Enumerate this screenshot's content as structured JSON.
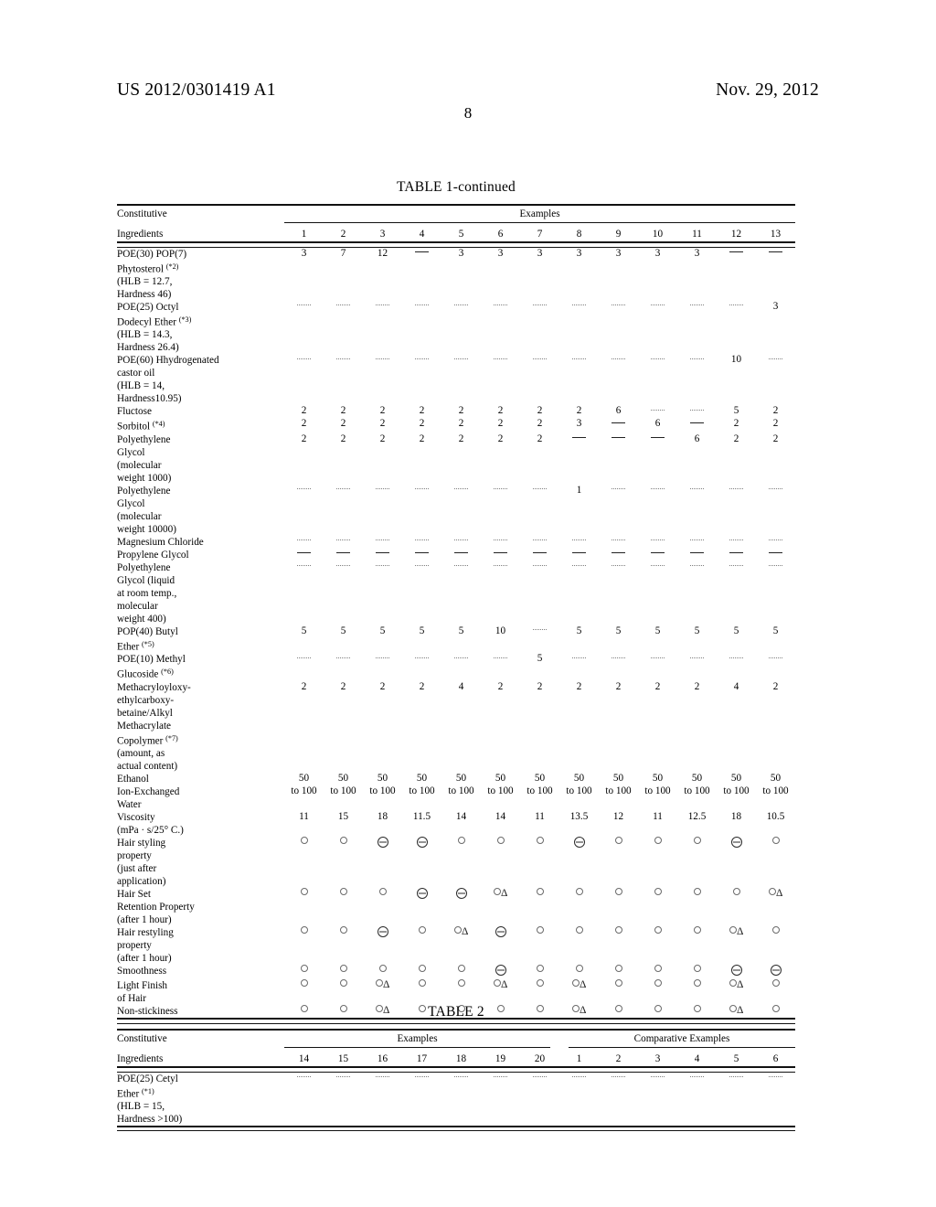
{
  "header": {
    "patent_number": "US 2012/0301419 A1",
    "date": "Nov. 29, 2012",
    "page_number": "8"
  },
  "table1": {
    "caption": "TABLE 1-continued",
    "stub_header_line1": "Constitutive",
    "stub_header_line2": "Ingredients",
    "groups": [
      {
        "label": "Examples",
        "span": 13
      }
    ],
    "columns": [
      "1",
      "2",
      "3",
      "4",
      "5",
      "6",
      "7",
      "8",
      "9",
      "10",
      "11",
      "12",
      "13"
    ],
    "rows": [
      {
        "label": "POE(30) POP(7)\nPhytosterol (*2)\n(HLB = 12.7,\nHardness 46)",
        "label_sup": "*2",
        "values": [
          "3",
          "7",
          "12",
          "DASH",
          "3",
          "3",
          "3",
          "3",
          "3",
          "3",
          "3",
          "DASH",
          "DASH"
        ]
      },
      {
        "label": "POE(25) Octyl\nDodecyl Ether (*3)\n(HLB = 14.3,\nHardness 26.4)",
        "label_sup": "*3",
        "values": [
          "FAINT",
          "FAINT",
          "FAINT",
          "FAINT",
          "FAINT",
          "FAINT",
          "FAINT",
          "FAINT",
          "FAINT",
          "FAINT",
          "FAINT",
          "FAINT",
          "3"
        ]
      },
      {
        "label": "POE(60) Hhydrogenated\ncastor oil\n(HLB = 14,\nHardness10.95)",
        "values": [
          "FAINT",
          "FAINT",
          "FAINT",
          "FAINT",
          "FAINT",
          "FAINT",
          "FAINT",
          "FAINT",
          "FAINT",
          "FAINT",
          "FAINT",
          "10",
          "FAINT"
        ]
      },
      {
        "label": "Fluctose",
        "values": [
          "2",
          "2",
          "2",
          "2",
          "2",
          "2",
          "2",
          "2",
          "6",
          "FAINT",
          "FAINT",
          "5",
          "2"
        ]
      },
      {
        "label": "Sorbitol (*4)",
        "label_sup": "*4",
        "values": [
          "2",
          "2",
          "2",
          "2",
          "2",
          "2",
          "2",
          "3",
          "DASH",
          "6",
          "DASH",
          "2",
          "2"
        ]
      },
      {
        "label": "Polyethylene\nGlycol\n(molecular\nweight 1000)",
        "values": [
          "2",
          "2",
          "2",
          "2",
          "2",
          "2",
          "2",
          "DASH",
          "DASH",
          "DASH",
          "6",
          "2",
          "2"
        ]
      },
      {
        "label": "Polyethylene\nGlycol\n(molecular\nweight 10000)",
        "values": [
          "FAINT",
          "FAINT",
          "FAINT",
          "FAINT",
          "FAINT",
          "FAINT",
          "FAINT",
          "1",
          "FAINT",
          "FAINT",
          "FAINT",
          "FAINT",
          "FAINT"
        ]
      },
      {
        "label": "Magnesium Chloride",
        "values": [
          "FAINT",
          "FAINT",
          "FAINT",
          "FAINT",
          "FAINT",
          "FAINT",
          "FAINT",
          "FAINT",
          "FAINT",
          "FAINT",
          "FAINT",
          "FAINT",
          "FAINT"
        ]
      },
      {
        "label": "Propylene Glycol",
        "values": [
          "DASH",
          "DASH",
          "DASH",
          "DASH",
          "DASH",
          "DASH",
          "DASH",
          "DASH",
          "DASH",
          "DASH",
          "DASH",
          "DASH",
          "DASH"
        ]
      },
      {
        "label": "Polyethylene\nGlycol (liquid\nat room temp.,\nmolecular\nweight 400)",
        "values": [
          "FAINT",
          "FAINT",
          "FAINT",
          "FAINT",
          "FAINT",
          "FAINT",
          "FAINT",
          "FAINT",
          "FAINT",
          "FAINT",
          "FAINT",
          "FAINT",
          "FAINT"
        ]
      },
      {
        "label": "POP(40) Butyl\nEther (*5)",
        "label_sup": "*5",
        "values": [
          "5",
          "5",
          "5",
          "5",
          "5",
          "10",
          "FAINT",
          "5",
          "5",
          "5",
          "5",
          "5",
          "5"
        ]
      },
      {
        "label": "POE(10) Methyl\nGlucoside (*6)",
        "label_sup": "*6",
        "values": [
          "FAINT",
          "FAINT",
          "FAINT",
          "FAINT",
          "FAINT",
          "FAINT",
          "5",
          "FAINT",
          "FAINT",
          "FAINT",
          "FAINT",
          "FAINT",
          "FAINT"
        ]
      },
      {
        "label": "Methacryloyloxy-\nethylcarboxy-\nbetaine/Alkyl\nMethacrylate\nCopolymer (*7)\n(amount, as\nactual content)",
        "label_sup": "*7",
        "values": [
          "2",
          "2",
          "2",
          "2",
          "4",
          "2",
          "2",
          "2",
          "2",
          "2",
          "2",
          "4",
          "2"
        ]
      },
      {
        "label": "Ethanol",
        "values": [
          "50",
          "50",
          "50",
          "50",
          "50",
          "50",
          "50",
          "50",
          "50",
          "50",
          "50",
          "50",
          "50"
        ]
      },
      {
        "label": "Ion-Exchanged\nWater",
        "values": [
          "to 100",
          "to 100",
          "to 100",
          "to 100",
          "to 100",
          "to 100",
          "to 100",
          "to 100",
          "to 100",
          "to 100",
          "to 100",
          "to 100",
          "to 100"
        ]
      },
      {
        "label": "Viscosity\n(mPa · s/25° C.)",
        "values": [
          "11",
          "15",
          "18",
          "11.5",
          "14",
          "14",
          "11",
          "13.5",
          "12",
          "11",
          "12.5",
          "18",
          "10.5"
        ]
      },
      {
        "label": "Hair styling\nproperty\n(just after\napplication)",
        "values": [
          "CIRCLE",
          "CIRCLE",
          "CDASH",
          "CDASH",
          "CIRCLE",
          "CIRCLE",
          "CIRCLE",
          "CDASH",
          "CIRCLE",
          "CIRCLE",
          "CIRCLE",
          "CDASH",
          "CIRCLE"
        ]
      },
      {
        "label": "Hair Set\nRetention Property\n(after 1 hour)",
        "values": [
          "CIRCLE",
          "CIRCLE",
          "CIRCLE",
          "CDASH",
          "CDASH",
          "CIRCTRI",
          "CIRCLE",
          "CIRCLE",
          "CIRCLE",
          "CIRCLE",
          "CIRCLE",
          "CIRCLE",
          "CIRCTRI"
        ]
      },
      {
        "label": "Hair restyling\nproperty\n(after 1 hour)",
        "values": [
          "CIRCLE",
          "CIRCLE",
          "CDASH",
          "CIRCLE",
          "CIRCTRI",
          "CDASH",
          "CIRCLE",
          "CIRCLE",
          "CIRCLE",
          "CIRCLE",
          "CIRCLE",
          "CIRCTRI",
          "CIRCLE"
        ]
      },
      {
        "label": "Smoothness",
        "values": [
          "CIRCLE",
          "CIRCLE",
          "CIRCLE",
          "CIRCLE",
          "CIRCLE",
          "CDASH",
          "CIRCLE",
          "CIRCLE",
          "CIRCLE",
          "CIRCLE",
          "CIRCLE",
          "CDASH",
          "CDASH"
        ]
      },
      {
        "label": "Light Finish\nof Hair",
        "values": [
          "CIRCLE",
          "CIRCLE",
          "CIRCTRI",
          "CIRCLE",
          "CIRCLE",
          "CIRCTRI",
          "CIRCLE",
          "CIRCTRI",
          "CIRCLE",
          "CIRCLE",
          "CIRCLE",
          "CIRCTRI",
          "CIRCLE"
        ]
      },
      {
        "label": "Non-stickiness",
        "values": [
          "CIRCLE",
          "CIRCLE",
          "CIRCTRI",
          "CIRCLE",
          "CIRCLE",
          "CIRCLE",
          "CIRCLE",
          "CIRCTRI",
          "CIRCLE",
          "CIRCLE",
          "CIRCLE",
          "CIRCTRI",
          "CIRCLE"
        ]
      }
    ]
  },
  "table2": {
    "caption": "TABLE 2",
    "stub_header_line1": "Constitutive",
    "stub_header_line2": "Ingredients",
    "groups": [
      {
        "label": "Examples",
        "span": 7
      },
      {
        "label": "Comparative Examples",
        "span": 6
      }
    ],
    "columns": [
      "14",
      "15",
      "16",
      "17",
      "18",
      "19",
      "20",
      "1",
      "2",
      "3",
      "4",
      "5",
      "6"
    ],
    "rows": [
      {
        "label": "POE(25) Cetyl\nEther (*1)\n(HLB = 15,\nHardness >100)",
        "label_sup": "*1",
        "values": [
          "FAINT",
          "FAINT",
          "FAINT",
          "FAINT",
          "FAINT",
          "FAINT",
          "FAINT",
          "FAINT",
          "FAINT",
          "FAINT",
          "FAINT",
          "FAINT",
          "FAINT"
        ]
      }
    ]
  }
}
